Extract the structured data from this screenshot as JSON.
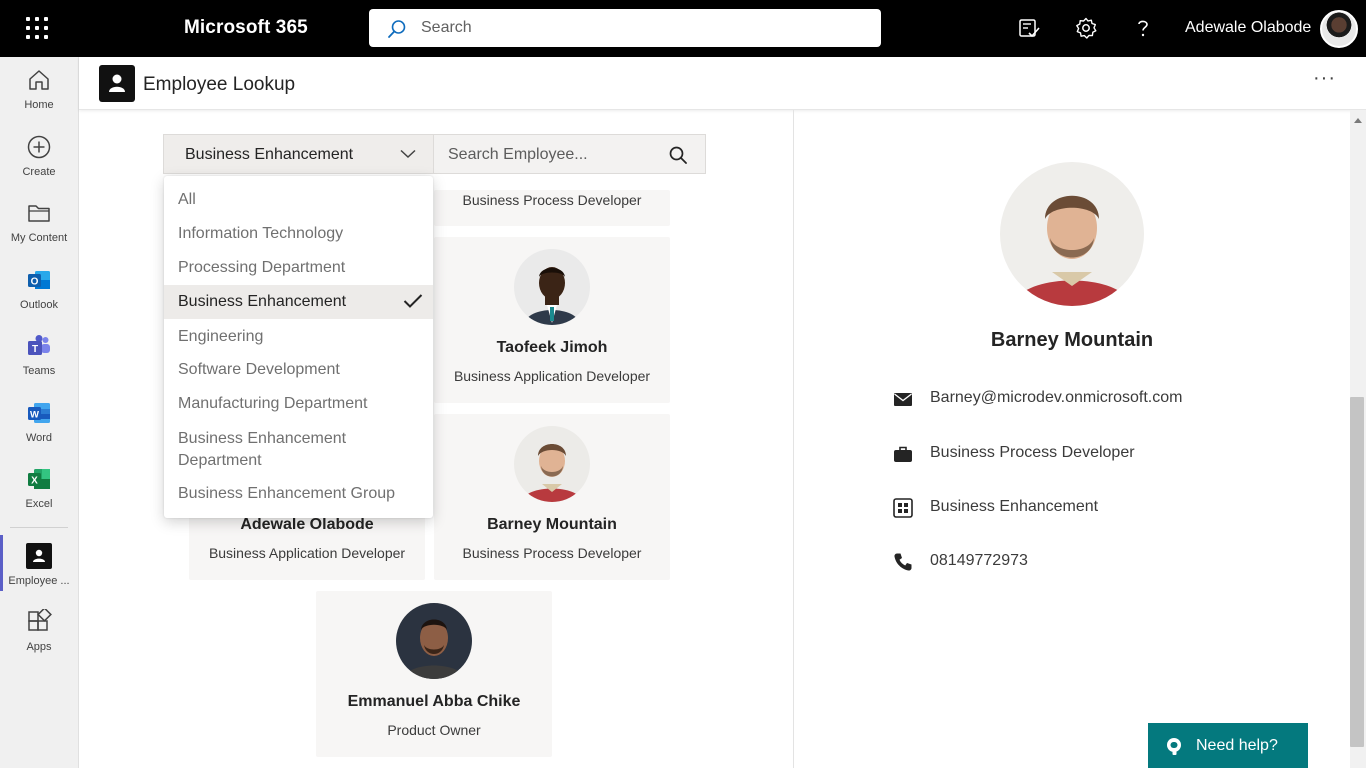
{
  "topbar": {
    "brand": "Microsoft 365",
    "search_placeholder": "Search",
    "user_name": "Adewale Olabode",
    "icons": [
      "waffle-icon",
      "search-icon",
      "tasks-icon",
      "settings-icon",
      "help-icon"
    ]
  },
  "rail": {
    "items": [
      {
        "label": "Home",
        "icon": "home-icon"
      },
      {
        "label": "Create",
        "icon": "create-icon"
      },
      {
        "label": "My Content",
        "icon": "folder-icon"
      },
      {
        "label": "Outlook",
        "icon": "outlook-icon"
      },
      {
        "label": "Teams",
        "icon": "teams-icon"
      },
      {
        "label": "Word",
        "icon": "word-icon"
      },
      {
        "label": "Excel",
        "icon": "excel-icon"
      },
      {
        "label": "Employee ...",
        "icon": "employee-app-icon"
      },
      {
        "label": "Apps",
        "icon": "apps-icon"
      }
    ]
  },
  "app": {
    "title": "Employee Lookup",
    "more": "···"
  },
  "filter": {
    "selected": "Business Enhancement",
    "search_placeholder": "Search Employee...",
    "options": [
      "All",
      "Information Technology",
      "Processing Department",
      "Business Enhancement",
      "Engineering",
      "Software Development",
      "Manufacturing Department",
      "Business Enhancement Department",
      "Business Enhancement Group"
    ],
    "options_line1": {
      "7": "Business Enhancement"
    },
    "options_line2": {
      "7": "Department"
    }
  },
  "cards": [
    {
      "name": "",
      "role": "Business Process Developer"
    },
    {
      "name": "Taofeek Jimoh",
      "role": "Business Application Developer"
    },
    {
      "name": "Adewale Olabode",
      "role": "Business Application Developer"
    },
    {
      "name": "Barney Mountain",
      "role": "Business Process Developer"
    },
    {
      "name": "Emmanuel Abba Chike",
      "role": "Product Owner"
    }
  ],
  "details": {
    "name": "Barney Mountain",
    "email": "Barney@microdev.onmicrosoft.com",
    "job_title": "Business Process Developer",
    "department": "Business Enhancement",
    "phone": "08149772973"
  },
  "help": {
    "label": "Need help?"
  },
  "colors": {
    "accent": "#5b5fc7",
    "help_button": "#04797e",
    "topbar": "#000000"
  }
}
